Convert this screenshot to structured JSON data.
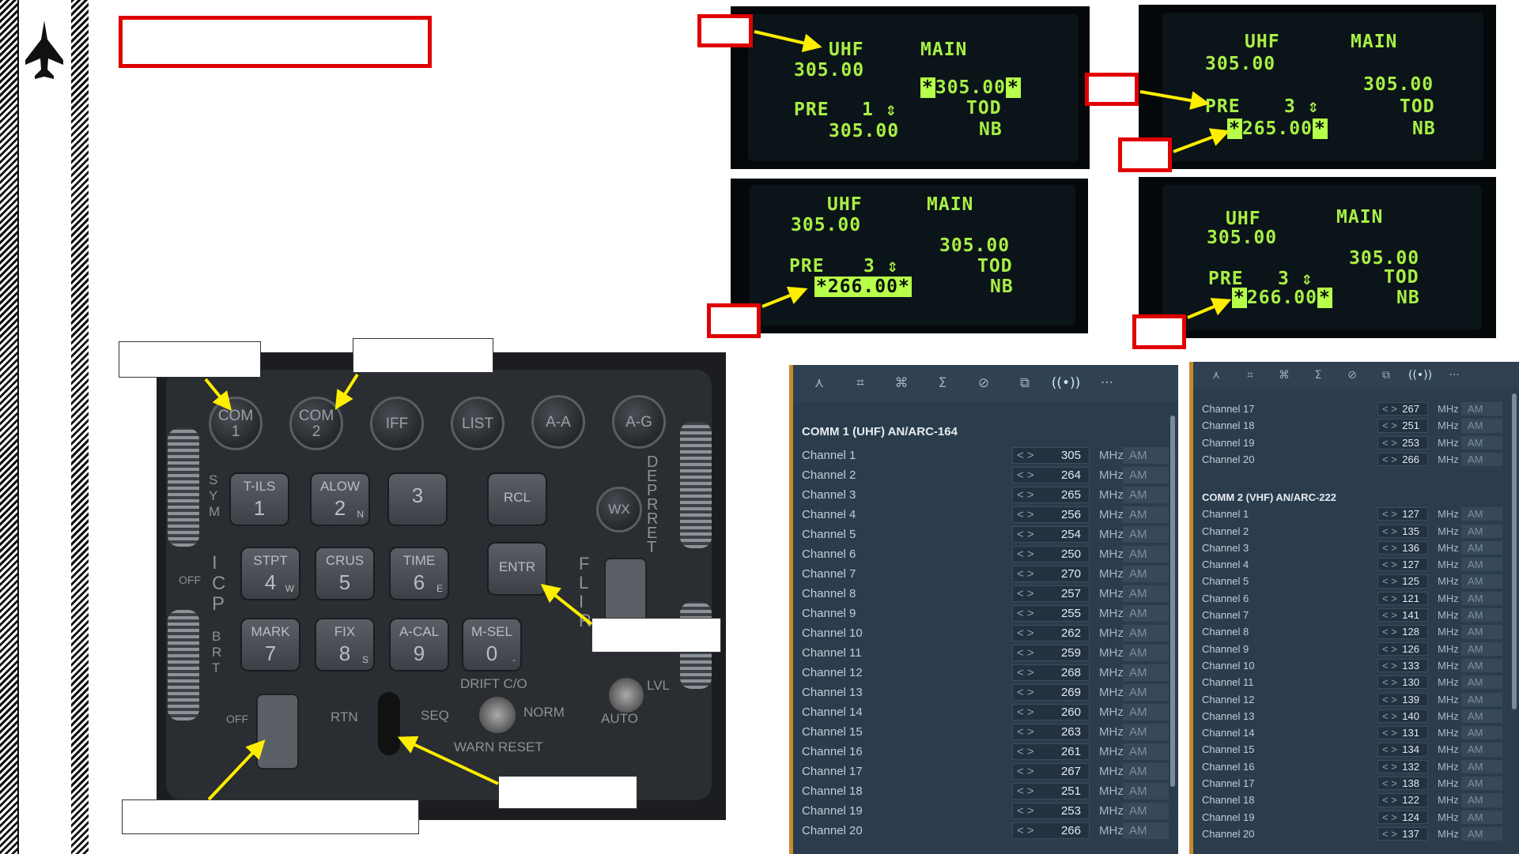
{
  "ded_screens": [
    {
      "rows": [
        "UHF       MAIN",
        "305.00",
        "",
        "PRE   1 ⇕  TOD",
        "  305.00     NB"
      ],
      "main_value": "305.00",
      "main_hl": true,
      "preset_value": "305.00",
      "preset_hl": false
    },
    {
      "rows": [
        "UHF       MAIN",
        "305.00"
      ],
      "main_value": "305.00",
      "preset_num": "3",
      "preset_value": "265.00",
      "preset_hl": true
    },
    {
      "main_value": "305.00",
      "preset_num": "3",
      "preset_value": "266.00",
      "preset_hl": true
    },
    {
      "main_value": "305.00",
      "preset_num": "3",
      "preset_value": "266.00",
      "preset_hl": true
    }
  ],
  "ded_labels": {
    "uhf": "UHF",
    "main": "MAIN",
    "freq": "305.00",
    "pre": "PRE",
    "tod": "TOD",
    "nb": "NB",
    "updown": "⇕"
  },
  "icp": {
    "round_buttons": [
      {
        "top": "COM",
        "bottom": "1"
      },
      {
        "top": "COM",
        "bottom": "2"
      },
      {
        "top": "IFF",
        "bottom": ""
      },
      {
        "top": "LIST",
        "bottom": ""
      },
      {
        "top": "A-A",
        "bottom": ""
      },
      {
        "top": "A-G",
        "bottom": ""
      }
    ],
    "keys": [
      {
        "t": "T-ILS",
        "n": "1",
        "s": ""
      },
      {
        "t": "ALOW",
        "n": "2",
        "s": "N"
      },
      {
        "t": "",
        "n": "3",
        "s": ""
      },
      {
        "t": "RCL",
        "n": "",
        "s": ""
      },
      {
        "t": "STPT",
        "n": "4",
        "s": "W"
      },
      {
        "t": "CRUS",
        "n": "5",
        "s": ""
      },
      {
        "t": "TIME",
        "n": "6",
        "s": "E"
      },
      {
        "t": "ENTR",
        "n": "",
        "s": ""
      },
      {
        "t": "MARK",
        "n": "7",
        "s": ""
      },
      {
        "t": "FIX",
        "n": "8",
        "s": "S"
      },
      {
        "t": "A-CAL",
        "n": "9",
        "s": ""
      },
      {
        "t": "M-SEL",
        "n": "0",
        "s": "-"
      }
    ],
    "labels": {
      "sym": "S\nY\nM",
      "icp": "I\nC\nP",
      "brt": "B\nR\nT",
      "off1": "OFF",
      "off2": "OFF",
      "rtn": "RTN",
      "seq": "SEQ",
      "norm": "NORM",
      "drift": "DRIFT C/O",
      "warn": "WARN RESET",
      "wx": "WX",
      "depr": "D\nE\nP\nR\nR\nE\nT",
      "flir": "F\nL\nI\nR",
      "lvl": "LVL",
      "auto": "AUTO"
    }
  },
  "panel1": {
    "tool_icons": [
      "pilot-icon",
      "crosshair-icon",
      "network-icon",
      "sigma-icon",
      "cancel-icon",
      "media-icon",
      "radio-icon",
      "more-icon"
    ],
    "tool_glyphs": [
      "⋏",
      "⌗",
      "⌘",
      "Σ",
      "⊘",
      "⧉",
      "((•))",
      "···"
    ],
    "title": "COMM 1 (UHF) AN/ARC-164",
    "unit": "MHz",
    "mod": "AM",
    "arrows": "< >",
    "channels": [
      {
        "label": "Channel 1",
        "value": "305"
      },
      {
        "label": "Channel 2",
        "value": "264"
      },
      {
        "label": "Channel 3",
        "value": "265"
      },
      {
        "label": "Channel 4",
        "value": "256"
      },
      {
        "label": "Channel 5",
        "value": "254"
      },
      {
        "label": "Channel 6",
        "value": "250"
      },
      {
        "label": "Channel 7",
        "value": "270"
      },
      {
        "label": "Channel 8",
        "value": "257"
      },
      {
        "label": "Channel 9",
        "value": "255"
      },
      {
        "label": "Channel 10",
        "value": "262"
      },
      {
        "label": "Channel 11",
        "value": "259"
      },
      {
        "label": "Channel 12",
        "value": "268"
      },
      {
        "label": "Channel 13",
        "value": "269"
      },
      {
        "label": "Channel 14",
        "value": "260"
      },
      {
        "label": "Channel 15",
        "value": "263"
      },
      {
        "label": "Channel 16",
        "value": "261"
      },
      {
        "label": "Channel 17",
        "value": "267"
      },
      {
        "label": "Channel 18",
        "value": "251"
      },
      {
        "label": "Channel 19",
        "value": "253"
      },
      {
        "label": "Channel 20",
        "value": "266"
      }
    ]
  },
  "panel2": {
    "tool_icons": [
      "pilot-icon",
      "crosshair-icon",
      "network-icon",
      "sigma-icon",
      "cancel-icon",
      "media-icon",
      "radio-icon",
      "more-icon"
    ],
    "tool_glyphs": [
      "⋏",
      "⌗",
      "⌘",
      "Σ",
      "⊘",
      "⧉",
      "((•))",
      "···"
    ],
    "unit": "MHz",
    "mod": "AM",
    "arrows": "< >",
    "top_channels": [
      {
        "label": "Channel 17",
        "value": "267"
      },
      {
        "label": "Channel 18",
        "value": "251"
      },
      {
        "label": "Channel 19",
        "value": "253"
      },
      {
        "label": "Channel 20",
        "value": "266"
      }
    ],
    "title": "COMM 2 (VHF) AN/ARC-222",
    "channels": [
      {
        "label": "Channel 1",
        "value": "127"
      },
      {
        "label": "Channel 2",
        "value": "135"
      },
      {
        "label": "Channel 3",
        "value": "136"
      },
      {
        "label": "Channel 4",
        "value": "127"
      },
      {
        "label": "Channel 5",
        "value": "125"
      },
      {
        "label": "Channel 6",
        "value": "121"
      },
      {
        "label": "Channel 7",
        "value": "141"
      },
      {
        "label": "Channel 8",
        "value": "128"
      },
      {
        "label": "Channel 9",
        "value": "126"
      },
      {
        "label": "Channel 10",
        "value": "133"
      },
      {
        "label": "Channel 11",
        "value": "130"
      },
      {
        "label": "Channel 12",
        "value": "139"
      },
      {
        "label": "Channel 13",
        "value": "140"
      },
      {
        "label": "Channel 14",
        "value": "131"
      },
      {
        "label": "Channel 15",
        "value": "134"
      },
      {
        "label": "Channel 16",
        "value": "132"
      },
      {
        "label": "Channel 17",
        "value": "138"
      },
      {
        "label": "Channel 18",
        "value": "122"
      },
      {
        "label": "Channel 19",
        "value": "124"
      },
      {
        "label": "Channel 20",
        "value": "137"
      }
    ]
  },
  "colors": {
    "arrow": "#ffee00",
    "callout_red": "#e00000",
    "ded_green": "#a8ef45",
    "panel_bg": "#2b3c4d",
    "panel_accent": "#c98a2a"
  }
}
